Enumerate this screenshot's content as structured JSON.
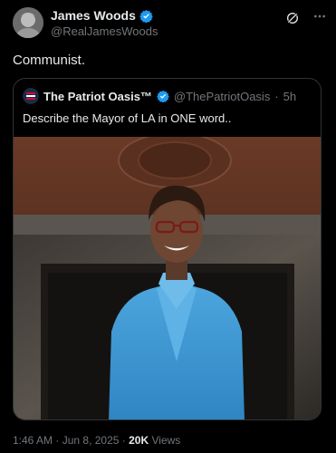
{
  "tweet": {
    "author_name": "James Woods",
    "author_handle": "@RealJamesWoods",
    "text": "Communist."
  },
  "quoted": {
    "author_name": "The Patriot Oasis™",
    "author_handle": "@ThePatriotOasis",
    "separator": "·",
    "age": "5h",
    "text": "Describe the Mayor of LA in ONE word.."
  },
  "footer": {
    "time": "1:46 AM",
    "dot1": "·",
    "date": "Jun 8, 2025",
    "dot2": "·",
    "views_count": "20K",
    "views_label": "Views"
  },
  "colors": {
    "background": "#000000",
    "text": "#e7e9ea",
    "muted": "#71767b",
    "verified": "#1d9bf0",
    "blazer": "#3f9ad4"
  },
  "icons": {
    "verified": "verified-badge-icon",
    "grok": "grok-icon",
    "more": "more-horizontal-icon"
  }
}
